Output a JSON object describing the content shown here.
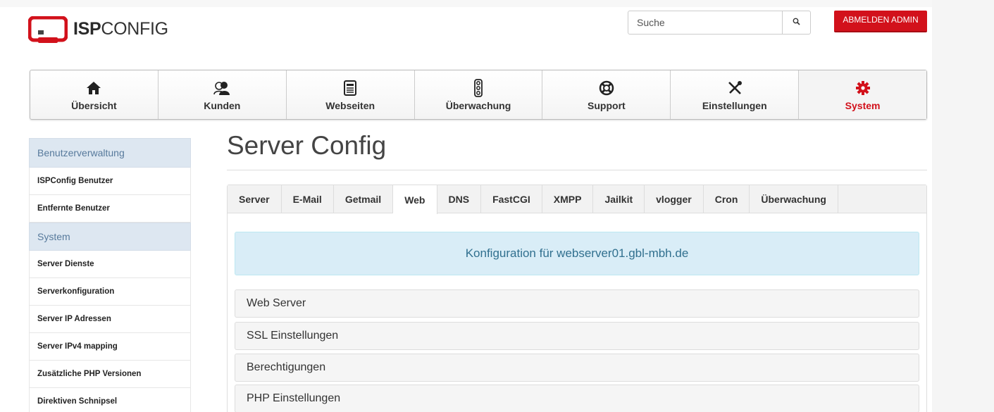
{
  "app": {
    "logo_bold": "ISP",
    "logo_light": "CONFIG"
  },
  "header": {
    "search_placeholder": "Suche",
    "logout_label": "ABMELDEN ADMIN",
    "accent_color": "#d2111b"
  },
  "mainnav": {
    "items": [
      {
        "label": "Übersicht",
        "icon": "home-icon"
      },
      {
        "label": "Kunden",
        "icon": "users-icon"
      },
      {
        "label": "Webseiten",
        "icon": "document-icon"
      },
      {
        "label": "Überwachung",
        "icon": "traffic-light-icon"
      },
      {
        "label": "Support",
        "icon": "lifebuoy-icon"
      },
      {
        "label": "Einstellungen",
        "icon": "tools-icon"
      },
      {
        "label": "System",
        "icon": "gear-icon",
        "active": true
      }
    ]
  },
  "sidebar": {
    "sections": [
      {
        "title": "Benutzerverwaltung",
        "items": [
          "ISPConfig Benutzer",
          "Entfernte Benutzer"
        ]
      },
      {
        "title": "System",
        "items": [
          "Server Dienste",
          "Serverkonfiguration",
          "Server IP Adressen",
          "Server IPv4 mapping",
          "Zusätzliche PHP Versionen",
          "Direktiven Schnipsel"
        ]
      }
    ]
  },
  "main": {
    "title": "Server Config",
    "tabs": [
      "Server",
      "E-Mail",
      "Getmail",
      "Web",
      "DNS",
      "FastCGI",
      "XMPP",
      "Jailkit",
      "vlogger",
      "Cron",
      "Überwachung"
    ],
    "active_tab": "Web",
    "info": "Konfiguration für webserver01.gbl-mbh.de",
    "sections": [
      "Web Server",
      "SSL Einstellungen",
      "Berechtigungen",
      "PHP Einstellungen"
    ]
  }
}
